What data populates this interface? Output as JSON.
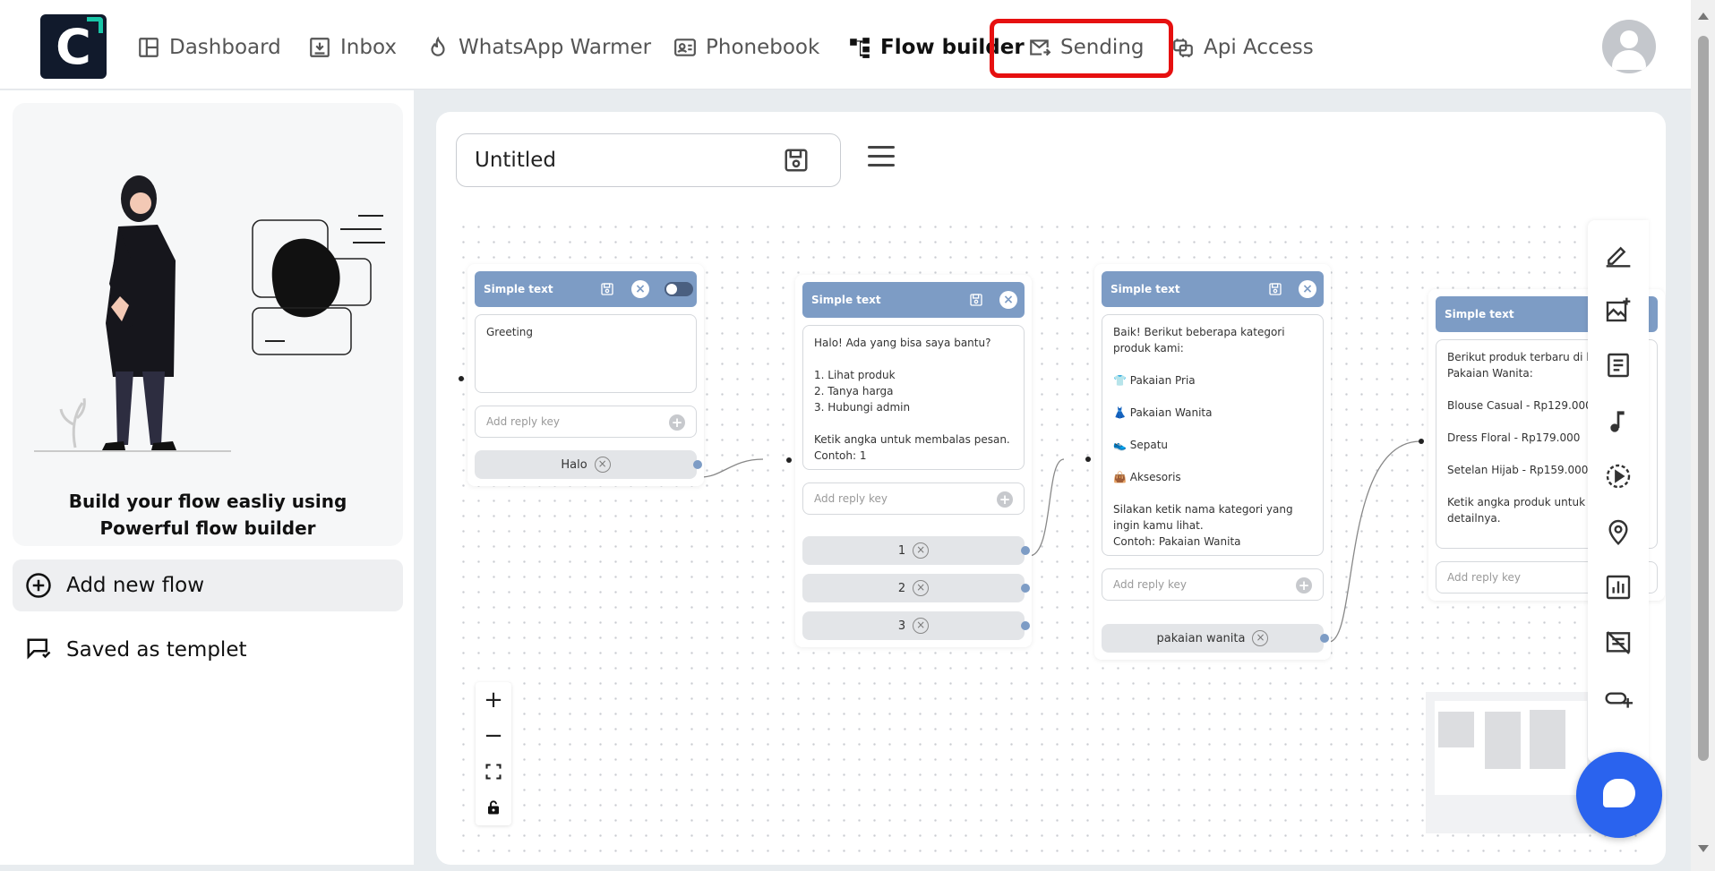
{
  "nav": {
    "logo_letter": "C",
    "items": [
      {
        "label": "Dashboard",
        "icon": "dashboard-icon"
      },
      {
        "label": "Inbox",
        "icon": "inbox-icon"
      },
      {
        "label": "WhatsApp Warmer",
        "icon": "flame-icon"
      },
      {
        "label": "Phonebook",
        "icon": "contact-card-icon"
      },
      {
        "label": "Flow builder",
        "icon": "flow-icon",
        "active": true
      },
      {
        "label": "Sending",
        "icon": "mail-send-icon",
        "highlighted": true
      },
      {
        "label": "Api Access",
        "icon": "api-icon"
      }
    ],
    "highlight_color": "#e61010"
  },
  "sidebar": {
    "hero_text": "Build your flow easliy using Powerful flow builder",
    "add_flow_label": "Add new flow",
    "saved_label": "Saved as templet"
  },
  "editor": {
    "flow_name": "Untitled",
    "nodes": [
      {
        "title": "Simple text",
        "body": "Greeting",
        "reply_placeholder": "Add reply key",
        "keys": [
          "Halo"
        ],
        "has_toggle": true
      },
      {
        "title": "Simple text",
        "body": "Halo! Ada yang bisa saya bantu?\n\n1. Lihat produk\n2. Tanya harga\n3. Hubungi admin\n\nKetik angka untuk membalas pesan.\nContoh: 1",
        "reply_placeholder": "Add reply key",
        "keys": [
          "1",
          "2",
          "3"
        ]
      },
      {
        "title": "Simple text",
        "body": "Baik! Berikut beberapa kategori produk kami:\n\n👕 Pakaian Pria\n\n👗 Pakaian Wanita\n\n👟 Sepatu\n\n👜 Aksesoris\n\nSilakan ketik nama kategori yang ingin kamu lihat.\nContoh: Pakaian Wanita",
        "reply_placeholder": "Add reply key",
        "keys": [
          "pakaian wanita"
        ]
      },
      {
        "title": "Simple text",
        "body": "Berikut produk terbaru di kategori Pakaian Wanita:\n\nBlouse Casual - Rp129.000\n\nDress Floral - Rp179.000\n\nSetelan Hijab - Rp159.000\n\nKetik angka produk untuk melihat detailnya.",
        "reply_placeholder": "Add reply key",
        "keys": []
      }
    ],
    "accent_color": "#7d9cc5"
  },
  "tools": [
    "edit-icon",
    "add-image-icon",
    "document-icon",
    "music-icon",
    "video-icon",
    "location-icon",
    "poll-icon",
    "list-off-icon",
    "link-icon"
  ],
  "zoom_controls": [
    "zoom-in-icon",
    "zoom-out-icon",
    "fit-view-icon",
    "lock-icon"
  ]
}
